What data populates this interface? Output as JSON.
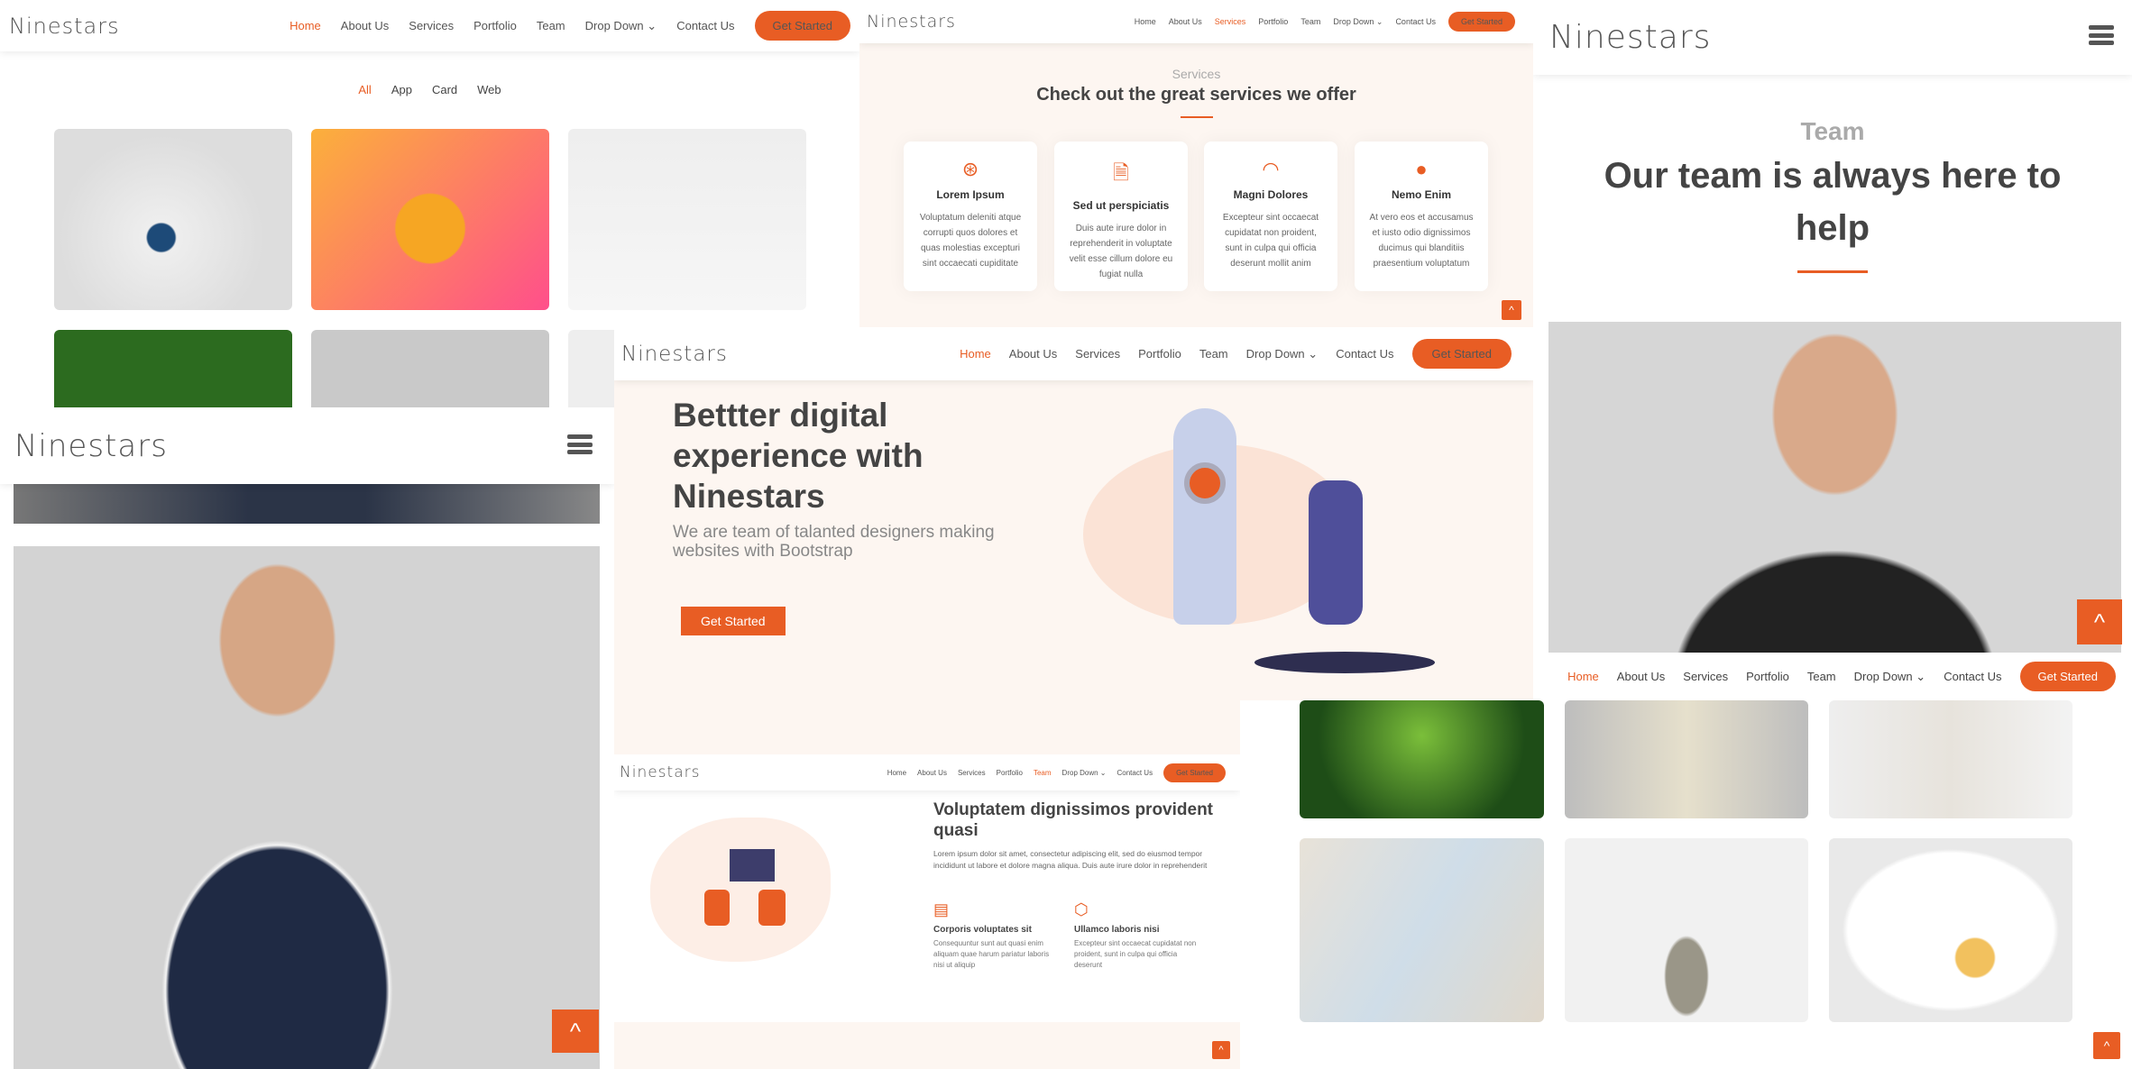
{
  "brand": "Ninestars",
  "nav": {
    "items": [
      "Home",
      "About Us",
      "Services",
      "Portfolio",
      "Team",
      "Drop Down",
      "Contact Us"
    ],
    "cta": "Get Started"
  },
  "portfolio": {
    "filters": [
      "All",
      "App",
      "Card",
      "Web"
    ]
  },
  "services": {
    "kicker": "Services",
    "title": "Check out the great services we offer",
    "cards": [
      {
        "icon": "dribbble-icon",
        "title": "Lorem Ipsum",
        "text": "Voluptatum deleniti atque corrupti quos dolores et quas molestias excepturi sint occaecati cupiditate"
      },
      {
        "icon": "file-text-icon",
        "title": "Sed ut perspiciatis",
        "text": "Duis aute irure dolor in reprehenderit in voluptate velit esse cillum dolore eu fugiat nulla"
      },
      {
        "icon": "speedometer-icon",
        "title": "Magni Dolores",
        "text": "Excepteur sint occaecat cupidatat non proident, sunt in culpa qui officia deserunt mollit anim"
      },
      {
        "icon": "globe-icon",
        "title": "Nemo Enim",
        "text": "At vero eos et accusamus et iusto odio dignissimos ducimus qui blanditiis praesentium voluptatum"
      }
    ]
  },
  "team": {
    "kicker": "Team",
    "title": "Our team is always here to help"
  },
  "hero": {
    "title": "Bettter digital experience with Ninestars",
    "subtitle": "We are team of talanted designers making websites with Bootstrap",
    "cta": "Get Started"
  },
  "about": {
    "title": "Voluptatem dignissimos provident quasi",
    "text": "Lorem ipsum dolor sit amet, consectetur adipiscing elit, sed do eiusmod tempor incididunt ut labore et dolore magna aliqua. Duis aute irure dolor in reprehenderit",
    "features": [
      {
        "icon": "receipt-icon",
        "title": "Corporis voluptates sit",
        "text": "Consequuntur sunt aut quasi enim aliquam quae harum pariatur laboris nisi ut aliquip"
      },
      {
        "icon": "cube-icon",
        "title": "Ullamco laboris nisi",
        "text": "Excepteur sint occaecat cupidatat non proident, sunt in culpa qui officia deserunt"
      }
    ]
  },
  "colors": {
    "accent": "#e85d24",
    "cream": "#fdf6f1"
  }
}
